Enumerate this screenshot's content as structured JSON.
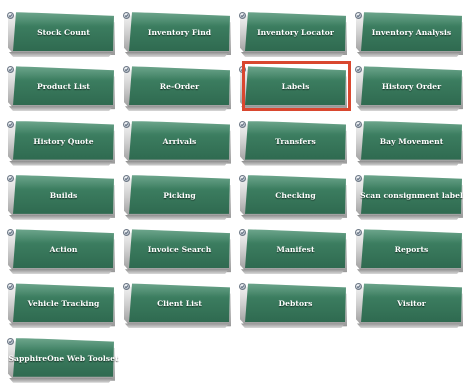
{
  "tiles": [
    {
      "label": "Stock Count"
    },
    {
      "label": "Inventory Find"
    },
    {
      "label": "Inventory Locator"
    },
    {
      "label": "Inventory Analysis"
    },
    {
      "label": "Product List"
    },
    {
      "label": "Re-Order"
    },
    {
      "label": "Labels",
      "selected": true
    },
    {
      "label": "History Order"
    },
    {
      "label": "History Quote"
    },
    {
      "label": "Arrivals"
    },
    {
      "label": "Transfers"
    },
    {
      "label": "Bay Movement"
    },
    {
      "label": "Builds"
    },
    {
      "label": "Picking"
    },
    {
      "label": "Checking"
    },
    {
      "label": "Scan consignment label"
    },
    {
      "label": "Action"
    },
    {
      "label": "Invoice Search"
    },
    {
      "label": "Manifest"
    },
    {
      "label": "Reports"
    },
    {
      "label": "Vehicle Tracking"
    },
    {
      "label": "Client List"
    },
    {
      "label": "Debtors"
    },
    {
      "label": "Visitor"
    },
    {
      "label": "SapphireOne Web Toolset"
    }
  ],
  "colors": {
    "tile_face": "#3b7c5f",
    "tile_text": "#ffffff",
    "selection_border": "#d9472f",
    "plate": "#cfcfcf"
  },
  "icons": {
    "badge": "check-badge-icon"
  }
}
